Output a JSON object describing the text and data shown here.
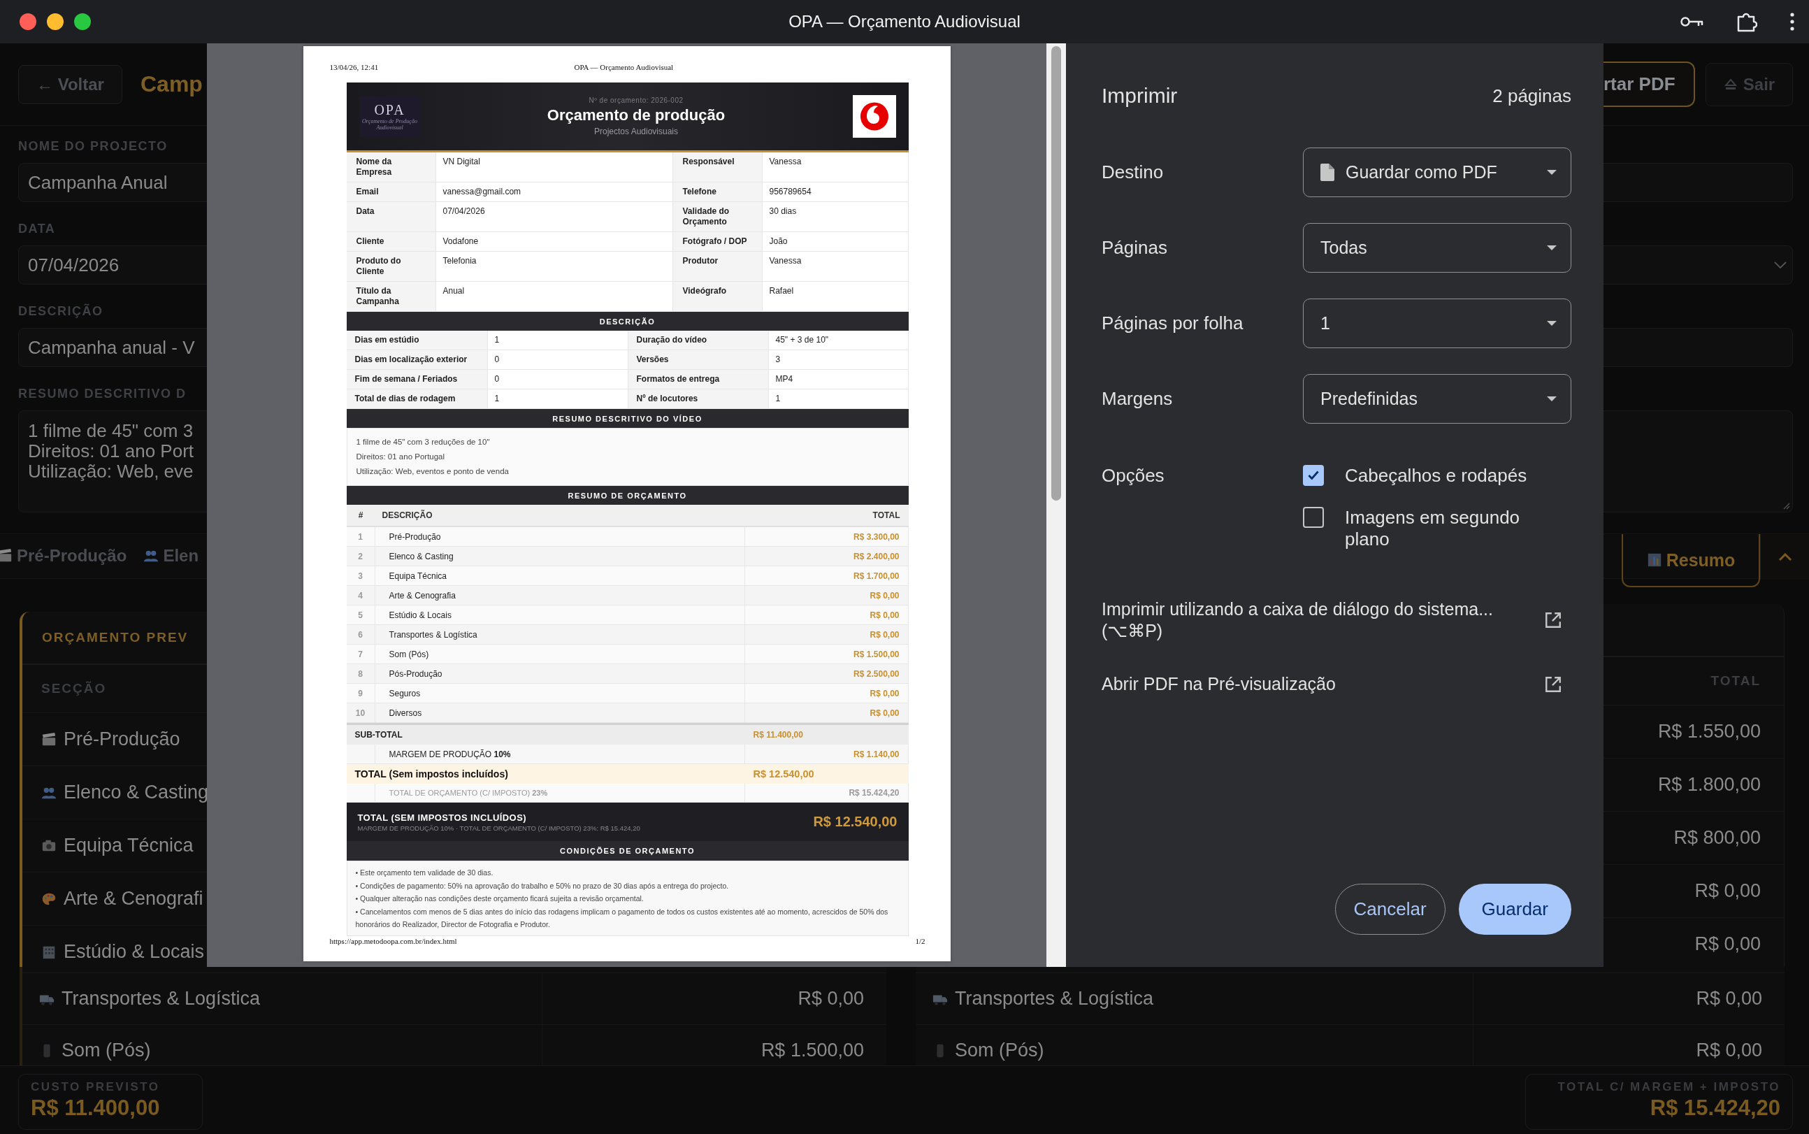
{
  "window": {
    "title": "OPA — Orçamento Audiovisual"
  },
  "app": {
    "back_button": "← Voltar",
    "page_title": "Camp",
    "export_button": "rtar PDF",
    "exit_button": "Sair",
    "fields": [
      {
        "label": "NOME DO PROJECTO",
        "value": "Campanha Anual"
      },
      {
        "label": "DATA",
        "value": "07/04/2026"
      },
      {
        "label": "DESCRIÇÃO",
        "value": "Campanha anual - V"
      },
      {
        "label": "RESUMO DESCRITIVO D",
        "lines": [
          "1 filme de 45\" com 3",
          "Direitos: 01 ano Port",
          "Utilização: Web, eve"
        ]
      }
    ],
    "tabs": [
      {
        "label": "Pré-Produção",
        "selected": false
      },
      {
        "label": "Elen",
        "selected": false
      },
      {
        "label": "Resumo",
        "selected": true
      }
    ],
    "budget_card": {
      "title": "ORÇAMENTO PREV",
      "column": "SECÇÃO",
      "sections": [
        "Pré-Produção",
        "Elenco & Casting",
        "Equipa Técnica",
        "Arte & Cenografi",
        "Estúdio & Locais"
      ]
    },
    "summary_card": {
      "column": "TOTAL",
      "totals": [
        "R$ 1.550,00",
        "R$ 1.800,00",
        "R$ 800,00",
        "R$ 0,00",
        "R$ 0,00"
      ]
    },
    "lower_rows": [
      {
        "left_section": "Transportes & Logística",
        "left_total": "R$ 0,00",
        "right_section": "Transportes & Logística",
        "right_total": "R$ 0,00"
      },
      {
        "left_section": "Som (Pós)",
        "left_total": "R$ 1.500,00",
        "right_section": "Som (Pós)",
        "right_total": "R$ 0,00"
      }
    ],
    "footer": [
      {
        "label": "CUSTO PREVISTO",
        "value": "R$ 11.400,00"
      },
      {
        "label": "TOTAL C/ MARGEM + IMPOSTO",
        "value": "R$ 15.424,20"
      }
    ]
  },
  "print_preview": {
    "header_left": "13/04/26, 12:41",
    "header_center": "OPA — Orçamento Audiovisual",
    "footer_left": "https://app.metodoopa.com.br/index.html",
    "footer_right": "1/2",
    "doc": {
      "logo_text": "OPA",
      "logo_subtitle": "Orçamento de Produção Audiovisual",
      "quote_number": "Nº de orçamento: 2026-002",
      "title": "Orçamento de produção",
      "subtitle": "Projectos Audiovisuais",
      "info_rows": [
        [
          {
            "label": "Nome da Empresa",
            "value": "VN Digital"
          },
          {
            "label": "Responsável",
            "value": "Vanessa"
          }
        ],
        [
          {
            "label": "Email",
            "value": "vanessa@gmail.com"
          },
          {
            "label": "Telefone",
            "value": "956789654"
          }
        ],
        [
          {
            "label": "Data",
            "value": "07/04/2026"
          },
          {
            "label": "Validade do Orçamento",
            "value": "30 dias"
          }
        ],
        [
          {
            "label": "Cliente",
            "value": "Vodafone"
          },
          {
            "label": "Fotógrafo / DOP",
            "value": "João"
          }
        ],
        [
          {
            "label": "Produto do Cliente",
            "value": "Telefonia"
          },
          {
            "label": "Produtor",
            "value": "Vanessa"
          }
        ],
        [
          {
            "label": "Título da Campanha",
            "value": "Anual"
          },
          {
            "label": "Videógrafo",
            "value": "Rafael"
          }
        ]
      ],
      "description_title": "DESCRIÇÃO",
      "description_rows": [
        [
          {
            "label": "Dias em estúdio",
            "value": "1"
          },
          {
            "label": "Duração do vídeo",
            "value": "45\" + 3 de 10\""
          }
        ],
        [
          {
            "label": "Dias em localização exterior",
            "value": "0"
          },
          {
            "label": "Versões",
            "value": "3"
          }
        ],
        [
          {
            "label": "Fim de semana / Feriados",
            "value": "0"
          },
          {
            "label": "Formatos de entrega",
            "value": "MP4"
          }
        ],
        [
          {
            "label": "Total de dias de rodagem",
            "value": "1"
          },
          {
            "label": "Nº de locutores",
            "value": "1"
          }
        ]
      ],
      "summary_title": "RESUMO DESCRITIVO DO VÍDEO",
      "summary_lines": [
        "1 filme de 45\" com 3 reduções de 10\"",
        "Direitos: 01 ano Portugal",
        "Utilização: Web, eventos e ponto de venda"
      ],
      "budget_title": "RESUMO DE ORÇAMENTO",
      "budget_columns": [
        "#",
        "DESCRIÇÃO",
        "TOTAL"
      ],
      "budget_rows": [
        {
          "number": "1",
          "name": "Pré-Produção",
          "total": "R$ 3.300,00"
        },
        {
          "number": "2",
          "name": "Elenco & Casting",
          "total": "R$ 2.400,00"
        },
        {
          "number": "3",
          "name": "Equipa Técnica",
          "total": "R$ 1.700,00"
        },
        {
          "number": "4",
          "name": "Arte & Cenografia",
          "total": "R$ 0,00"
        },
        {
          "number": "5",
          "name": "Estúdio & Locais",
          "total": "R$ 0,00"
        },
        {
          "number": "6",
          "name": "Transportes & Logística",
          "total": "R$ 0,00"
        },
        {
          "number": "7",
          "name": "Som (Pós)",
          "total": "R$ 1.500,00"
        },
        {
          "number": "8",
          "name": "Pós-Produção",
          "total": "R$ 2.500,00"
        },
        {
          "number": "9",
          "name": "Seguros",
          "total": "R$ 0,00"
        },
        {
          "number": "10",
          "name": "Diversos",
          "total": "R$ 0,00"
        }
      ],
      "subtotal": {
        "label": "SUB-TOTAL",
        "value": "R$ 11.400,00"
      },
      "margin": {
        "label": "MARGEM DE PRODUÇÃO **10%**",
        "value": "R$ 1.140,00"
      },
      "total": {
        "label": "TOTAL (Sem impostos incluídos)",
        "value": "R$ 12.540,00"
      },
      "tax_total": {
        "label": "TOTAL DE ORÇAMENTO (C/ IMPOSTO) **23%**",
        "value": "R$ 15.424,20"
      },
      "total_banner": {
        "title": "TOTAL (SEM IMPOSTOS INCLUÍDOS)",
        "detail": "MARGEM DE PRODUÇÃO 10% · TOTAL DE ORÇAMENTO (C/ IMPOSTO) 23%: R$ 15.424,20",
        "value": "R$ 12.540,00"
      },
      "conditions_title": "CONDIÇÕES DE ORÇAMENTO",
      "conditions": [
        "• Este orçamento tem validade de 30 dias.",
        "• Condições de pagamento: 50% na aprovação do trabalho e 50% no prazo de 30 dias após a entrega do projecto.",
        "• Qualquer alteração nas condições deste orçamento ficará sujeita a revisão orçamental.",
        "• Cancelamentos com menos de 5 dias antes do início das rodagens implicam o pagamento de todos os custos existentes até ao momento, acrescidos de 50% dos honorários do Realizador, Director de Fotografia e Produtor."
      ]
    }
  },
  "print_dialog": {
    "title": "Imprimir",
    "page_count": "2 páginas",
    "settings": [
      {
        "label": "Destino",
        "value": "Guardar como PDF"
      },
      {
        "label": "Páginas",
        "value": "Todas"
      },
      {
        "label": "Páginas por folha",
        "value": "1"
      },
      {
        "label": "Margens",
        "value": "Predefinidas"
      }
    ],
    "options_label": "Opções",
    "options": [
      {
        "label": "Cabeçalhos e rodapés",
        "checked": true
      },
      {
        "label": "Imagens em segundo plano",
        "checked": false
      }
    ],
    "links": [
      "Imprimir utilizando a caixa de diálogo do sistema... (⌥⌘P)",
      "Abrir PDF na Pré-visualização"
    ],
    "buttons": [
      {
        "label": "Cancelar",
        "kind": "secondary"
      },
      {
        "label": "Guardar",
        "kind": "primary"
      }
    ]
  }
}
